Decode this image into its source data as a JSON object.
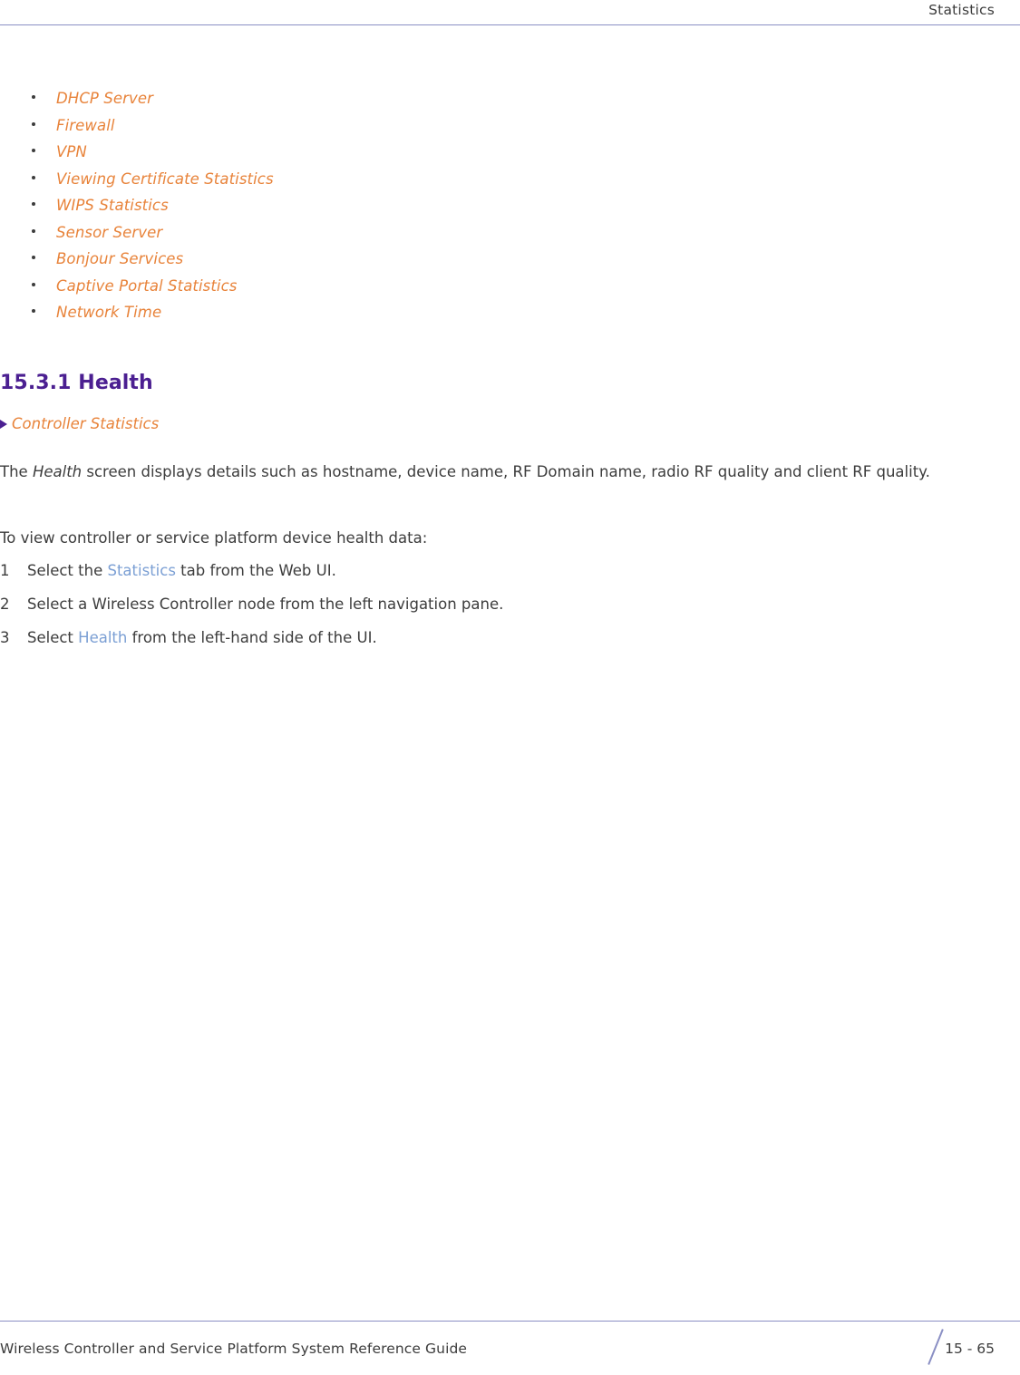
{
  "header": {
    "title": "Statistics"
  },
  "bullet_list": [
    {
      "label": "DHCP Server"
    },
    {
      "label": "Firewall"
    },
    {
      "label": "VPN"
    },
    {
      "label": "Viewing Certificate Statistics"
    },
    {
      "label": "WIPS Statistics"
    },
    {
      "label": "Sensor Server"
    },
    {
      "label": "Bonjour Services"
    },
    {
      "label": "Captive Portal Statistics"
    },
    {
      "label": "Network Time"
    }
  ],
  "section": {
    "heading": "15.3.1 Health",
    "parent_reference": "Controller Statistics",
    "intro_part1": "The ",
    "intro_italic": "Health",
    "intro_part2": " screen displays details such as hostname, device name, RF Domain name, radio RF quality and client RF quality.",
    "lead_in": "To view controller or service platform device health data:"
  },
  "steps": [
    {
      "num": "1",
      "pre": "Select the ",
      "link": "Statistics",
      "post": " tab from the Web UI."
    },
    {
      "num": "2",
      "pre": "Select a Wireless Controller node from the left navigation pane.",
      "link": "",
      "post": ""
    },
    {
      "num": "3",
      "pre": "Select ",
      "link": "Health",
      "post": " from the left-hand side of the UI."
    }
  ],
  "footer": {
    "guide_title": "Wireless Controller and Service Platform System Reference Guide",
    "page_number": "15 - 65"
  },
  "colors": {
    "cross_reference": "#e8833a",
    "heading": "#4b1f91",
    "ui_link": "#7b9fd4",
    "rule": "#8a8fc4",
    "text": "#3c3c3c"
  }
}
